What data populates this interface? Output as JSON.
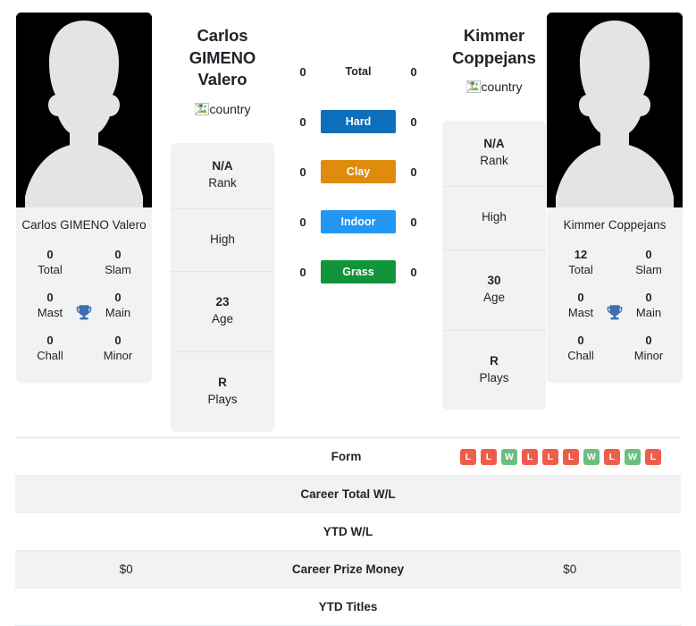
{
  "players": {
    "left": {
      "photo_name": "Carlos GIMENO Valero",
      "display_name": "Carlos GIMENO Valero",
      "country_alt": "country",
      "avatar_icon": "person-silhouette-photo",
      "titles": [
        {
          "value": "0",
          "label": "Total"
        },
        {
          "value": "0",
          "label": "Slam"
        },
        {
          "value": "0",
          "label": "Mast"
        },
        {
          "value": "0",
          "label": "Main"
        },
        {
          "value": "0",
          "label": "Chall"
        },
        {
          "value": "0",
          "label": "Minor"
        }
      ],
      "info": [
        {
          "value": "N/A",
          "label": "Rank"
        },
        {
          "value": "",
          "label": "High"
        },
        {
          "value": "23",
          "label": "Age"
        },
        {
          "value": "R",
          "label": "Plays"
        }
      ],
      "career_prize_money": "$0",
      "career_total_wl": "",
      "ytd_wl": "",
      "ytd_titles": "",
      "form": []
    },
    "right": {
      "photo_name": "Kimmer Coppejans",
      "display_name": "Kimmer Coppejans",
      "country_alt": "country",
      "avatar_icon": "person-silhouette-photo",
      "titles": [
        {
          "value": "12",
          "label": "Total"
        },
        {
          "value": "0",
          "label": "Slam"
        },
        {
          "value": "0",
          "label": "Mast"
        },
        {
          "value": "0",
          "label": "Main"
        },
        {
          "value": "0",
          "label": "Chall"
        },
        {
          "value": "0",
          "label": "Minor"
        }
      ],
      "info": [
        {
          "value": "N/A",
          "label": "Rank"
        },
        {
          "value": "",
          "label": "High"
        },
        {
          "value": "30",
          "label": "Age"
        },
        {
          "value": "R",
          "label": "Plays"
        }
      ],
      "career_prize_money": "$0",
      "career_total_wl": "",
      "ytd_wl": "",
      "ytd_titles": "",
      "form": [
        "L",
        "L",
        "W",
        "L",
        "L",
        "L",
        "W",
        "L",
        "W",
        "L"
      ]
    }
  },
  "surfaces": [
    {
      "name": "Total",
      "left_score": "0",
      "right_score": "0",
      "color": "transparent",
      "plain": true
    },
    {
      "name": "Hard",
      "left_score": "0",
      "right_score": "0",
      "color": "#0d6ebd",
      "plain": false
    },
    {
      "name": "Clay",
      "left_score": "0",
      "right_score": "0",
      "color": "#df8b0c",
      "plain": false
    },
    {
      "name": "Indoor",
      "left_score": "0",
      "right_score": "0",
      "color": "#2196f3",
      "plain": false
    },
    {
      "name": "Grass",
      "left_score": "0",
      "right_score": "0",
      "color": "#12943b",
      "plain": false
    }
  ],
  "table_rows": [
    {
      "label": "Form",
      "left": "",
      "right": "",
      "type": "form",
      "striped": false
    },
    {
      "label": "Career Total W/L",
      "left": "",
      "right": "",
      "type": "text",
      "striped": true
    },
    {
      "label": "YTD W/L",
      "left": "",
      "right": "",
      "type": "text",
      "striped": false
    },
    {
      "label": "Career Prize Money",
      "left": "$0",
      "right": "$0",
      "type": "text",
      "striped": true
    },
    {
      "label": "YTD Titles",
      "left": "",
      "right": "",
      "type": "text",
      "striped": false
    }
  ],
  "colors": {
    "win_badge": "#6ebe7f",
    "loss_badge": "#ef5d4a",
    "card_bg": "#f1f2f3",
    "trophy": "#3a6fb0",
    "stripe": "#f2f2f2"
  }
}
